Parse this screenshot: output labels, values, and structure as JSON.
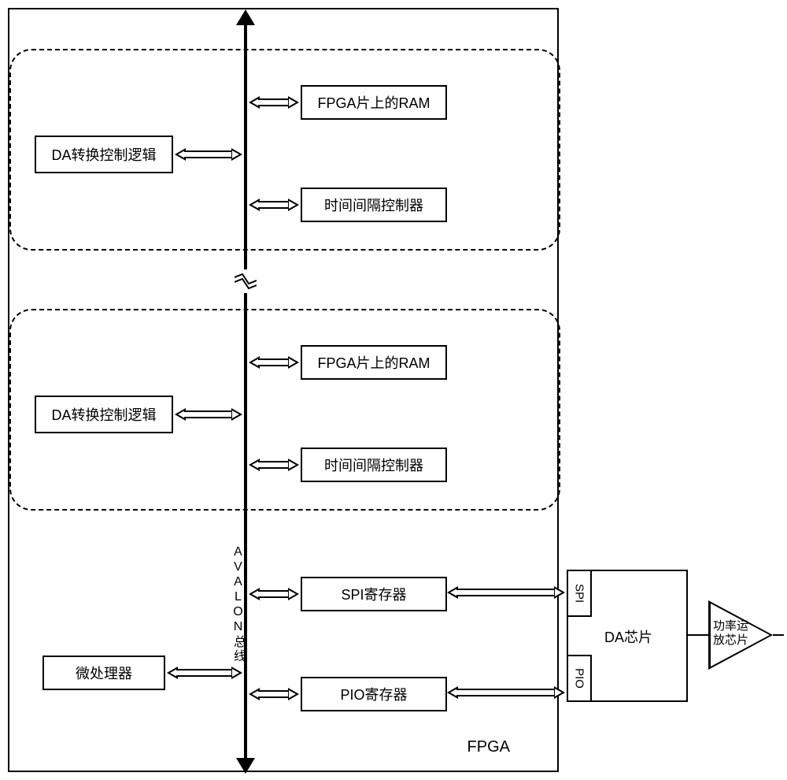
{
  "labels": {
    "fpga": "FPGA",
    "bus": "AVALON总线",
    "da_logic": "DA转换控制逻辑",
    "ram": "FPGA片上的RAM",
    "timer": "时间间隔控制器",
    "spi_reg": "SPI寄存器",
    "pio_reg": "PIO寄存器",
    "microproc": "微处理器",
    "da_chip": "DA芯片",
    "spi": "SPI",
    "pio": "PIO",
    "opamp_line1": "功率运",
    "opamp_line2": "放芯片"
  }
}
